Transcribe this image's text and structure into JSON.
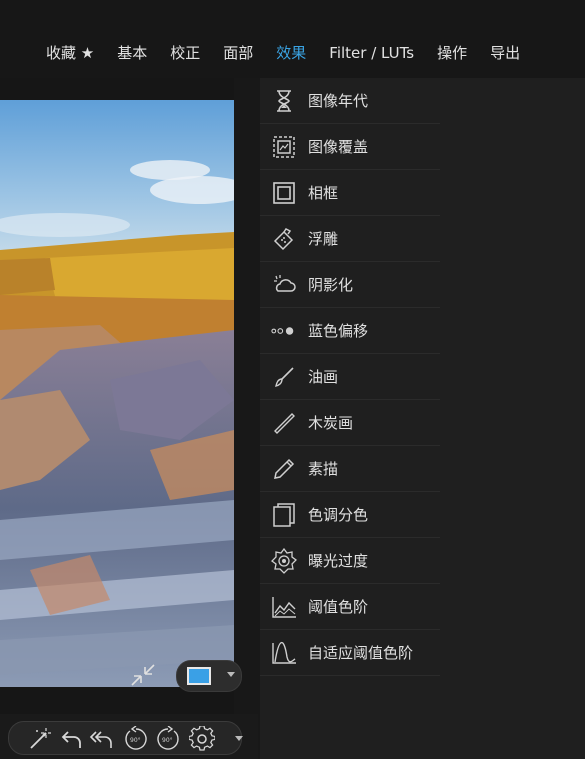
{
  "tabs": [
    {
      "label": "收藏 ★",
      "active": false
    },
    {
      "label": "基本",
      "active": false
    },
    {
      "label": "校正",
      "active": false
    },
    {
      "label": "面部",
      "active": false
    },
    {
      "label": "效果",
      "active": true
    },
    {
      "label": "Filter / LUTs",
      "active": false
    },
    {
      "label": "操作",
      "active": false
    },
    {
      "label": "导出",
      "active": false
    }
  ],
  "effects_menu": [
    {
      "label": "图像年代",
      "icon": "hourglass-icon"
    },
    {
      "label": "图像覆盖",
      "icon": "image-overlay-icon"
    },
    {
      "label": "相框",
      "icon": "frame-icon"
    },
    {
      "label": "浮雕",
      "icon": "emboss-icon"
    },
    {
      "label": "阴影化",
      "icon": "shadow-cloud-icon"
    },
    {
      "label": "蓝色偏移",
      "icon": "blue-shift-dots-icon"
    },
    {
      "label": "油画",
      "icon": "paint-brush-icon"
    },
    {
      "label": "木炭画",
      "icon": "charcoal-stick-icon"
    },
    {
      "label": "素描",
      "icon": "pencil-icon"
    },
    {
      "label": "色调分色",
      "icon": "split-tone-icon"
    },
    {
      "label": "曝光过度",
      "icon": "overexposure-icon"
    },
    {
      "label": "阈值色阶",
      "icon": "threshold-chart-icon"
    },
    {
      "label": "自适应阈值色阶",
      "icon": "adaptive-threshold-icon"
    }
  ],
  "toolbar": {
    "rotate_left_text": "90°",
    "rotate_right_text": "90°"
  },
  "colors": {
    "accent": "#3aa3e3",
    "background": "#161616",
    "menu_bg": "#1f1f1f"
  }
}
